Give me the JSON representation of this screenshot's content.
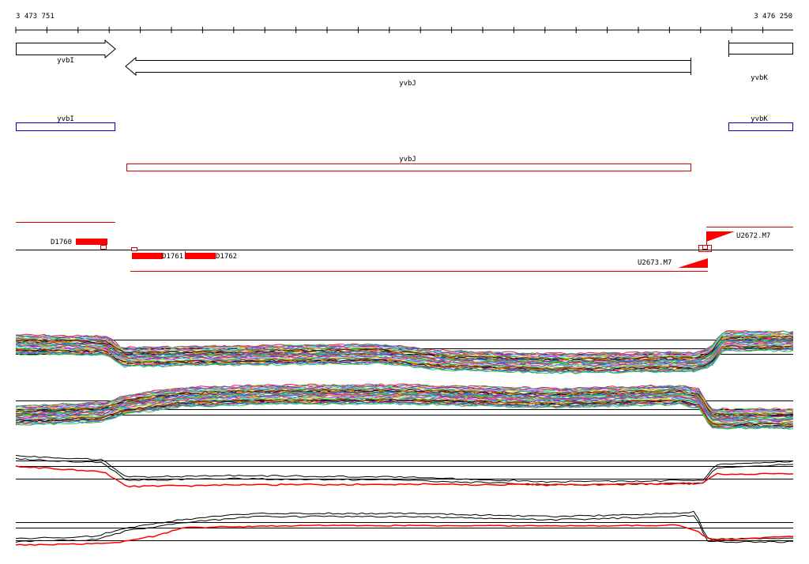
{
  "ruler": {
    "start_label": "3 473 751",
    "end_label": "3 476 250"
  },
  "genes": [
    {
      "name": "yvbI",
      "strand": "+"
    },
    {
      "name": "yvbJ",
      "strand": "-"
    },
    {
      "name": "yvbK",
      "strand": "+"
    }
  ],
  "transcripts": [
    {
      "name": "yvbI",
      "color": "#0000cc"
    },
    {
      "name": "yvbJ",
      "color": "#dd0000"
    },
    {
      "name": "yvbK",
      "color": "#0000cc"
    }
  ],
  "features": {
    "segments": [
      "D1760",
      "D1761",
      "D1762"
    ],
    "promoters": [
      "U2672.M7",
      "U2673.M7"
    ],
    "color": "#ff0000"
  },
  "colors": {
    "expression_palette": [
      "#e6194b",
      "#3cb44b",
      "#4363d8",
      "#f58231",
      "#911eb4",
      "#46f0f0",
      "#f032e6",
      "#bcf60c",
      "#00a0a0",
      "#9a6324",
      "#800000",
      "#808000",
      "#000075",
      "#ff8c00",
      "#008080",
      "#c71585",
      "#1e90ff",
      "#32cd32"
    ],
    "summary_line": "#000000",
    "summary_highlight": "#ff0000"
  }
}
